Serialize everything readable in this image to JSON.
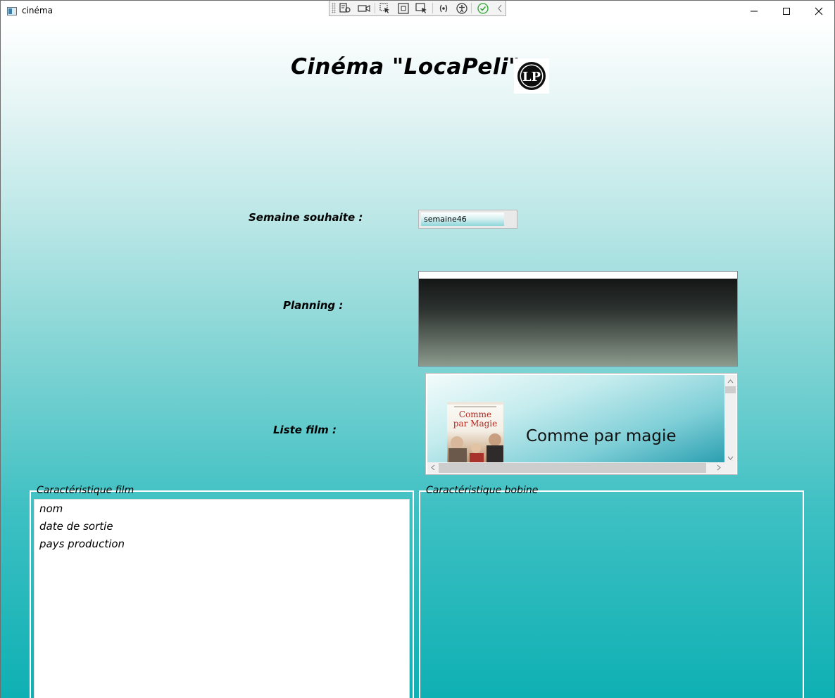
{
  "window": {
    "title": "cinéma",
    "controls": {
      "minimize": "minimize-icon",
      "maximize": "maximize-icon",
      "close": "close-icon"
    }
  },
  "debug_toolbar": {
    "tools": [
      "live-visual-tree-icon",
      "record-icon",
      "select-element-icon",
      "display-layout-adorners-icon",
      "track-focus-icon",
      "binding-failures-icon",
      "accessibility-icon",
      "check-icon",
      "collapse-chevron-icon"
    ]
  },
  "header": {
    "title": "Cinéma \"LocaPeli\"",
    "logo_text": "LP"
  },
  "labels": {
    "week": "Semaine souhaite :",
    "planning": "Planning  :",
    "film_list": "Liste film :"
  },
  "week_select": {
    "value": "semaine46"
  },
  "film_list": {
    "items": [
      {
        "name": "Comme par magie",
        "poster_title_line1": "Comme",
        "poster_title_line2": "par Magie"
      }
    ]
  },
  "film_details": {
    "legend": "Caractéristique film",
    "rows": [
      "nom",
      "date de sortie",
      "pays production"
    ]
  },
  "bobine_details": {
    "legend": "Caractéristique bobine"
  },
  "colors": {
    "accent_teal": "#0eb0b3",
    "poster_red": "#b3261e"
  }
}
